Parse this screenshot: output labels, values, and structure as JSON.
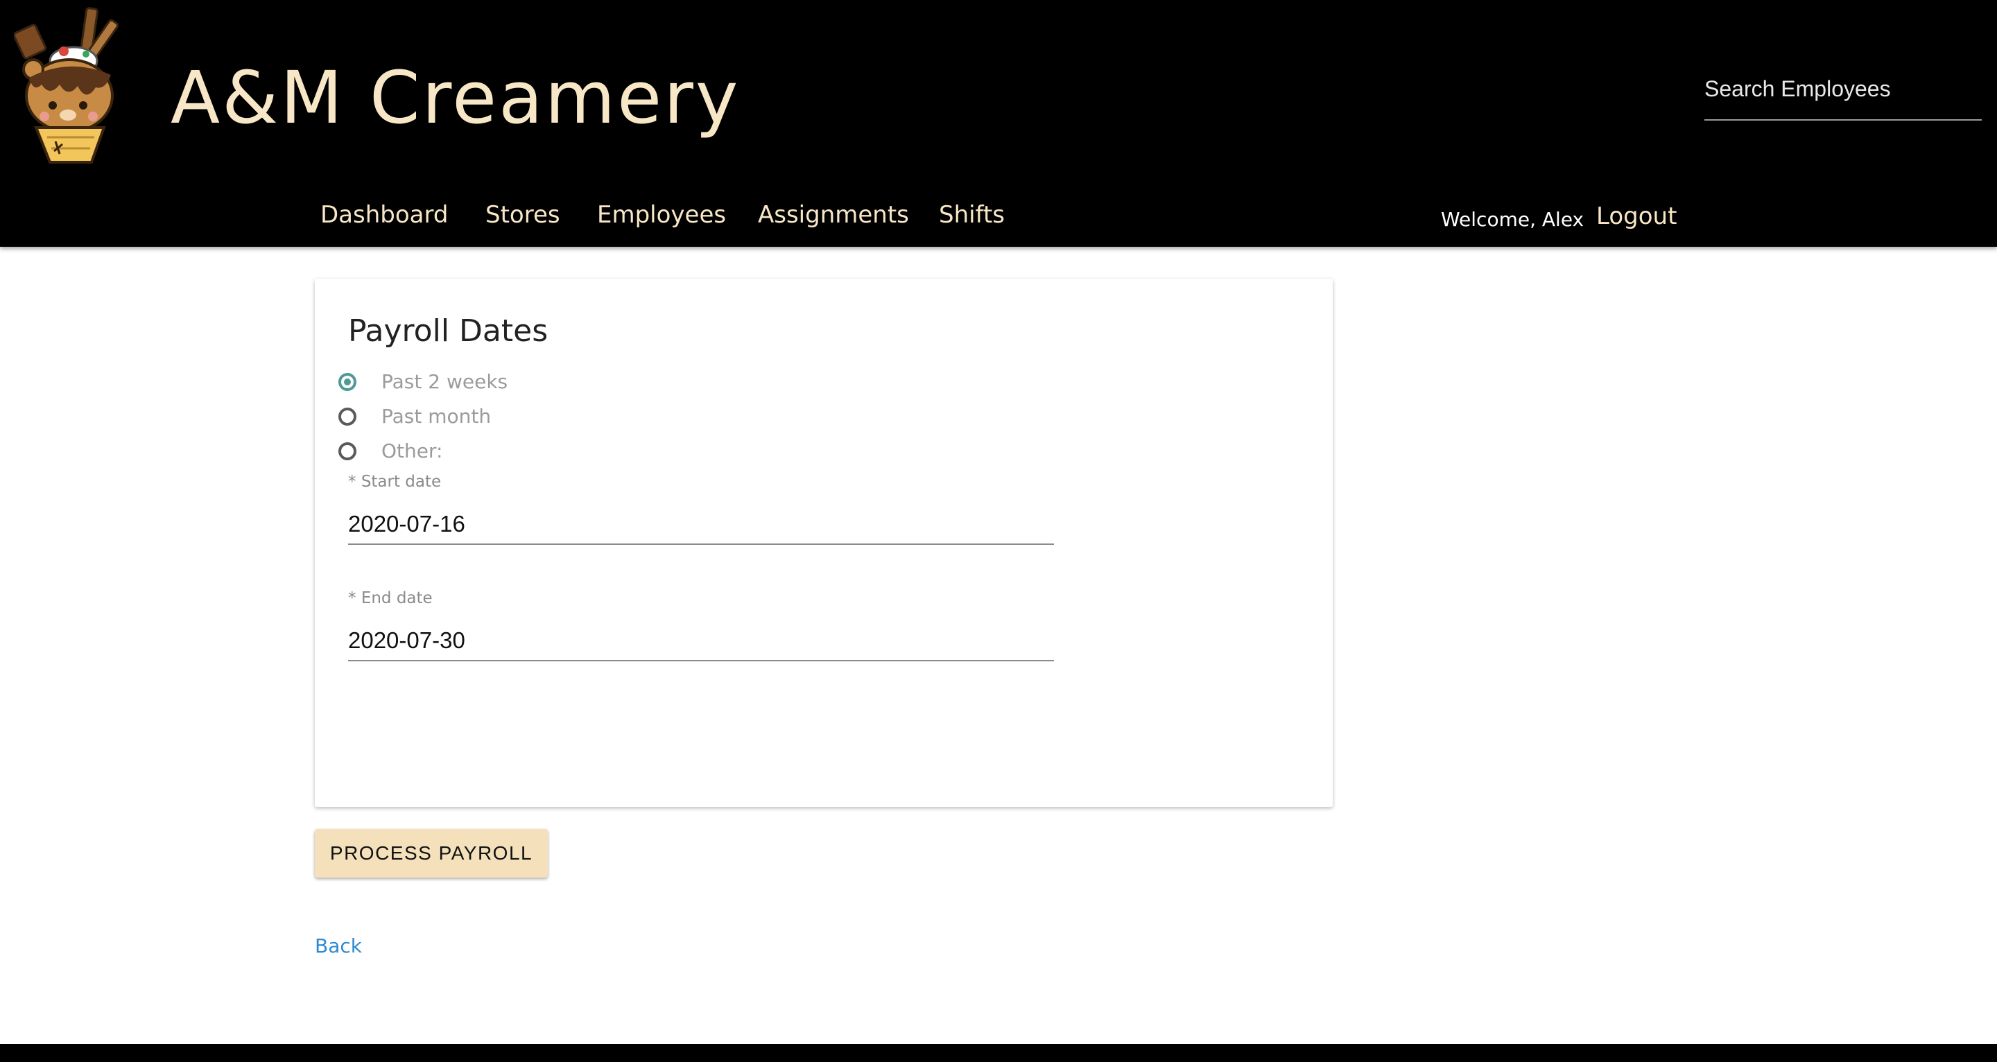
{
  "brand": {
    "name": "A&M Creamery"
  },
  "search": {
    "placeholder": "Search Employees"
  },
  "nav": {
    "items": [
      "Dashboard",
      "Stores",
      "Employees",
      "Assignments",
      "Shifts"
    ]
  },
  "user": {
    "welcome": "Welcome, Alex",
    "logout": "Logout"
  },
  "payroll": {
    "title": "Payroll Dates",
    "options": [
      {
        "label": "Past 2 weeks",
        "selected": true
      },
      {
        "label": "Past month",
        "selected": false
      },
      {
        "label": "Other:",
        "selected": false
      }
    ],
    "start": {
      "required_mark": "*",
      "label": "Start date",
      "value": "2020-07-16"
    },
    "end": {
      "required_mark": "*",
      "label": "End date",
      "value": "2020-07-30"
    }
  },
  "actions": {
    "process_label": "PROCESS PAYROLL",
    "back_label": "Back"
  },
  "colors": {
    "header_bg": "#000000",
    "brand_text": "#f8e7c6",
    "radio_accent": "#4f9a97",
    "button_bg": "#f4e1bb",
    "link": "#2f8ad0"
  },
  "icons": {
    "logo": "ice-cream-bear-logo"
  }
}
